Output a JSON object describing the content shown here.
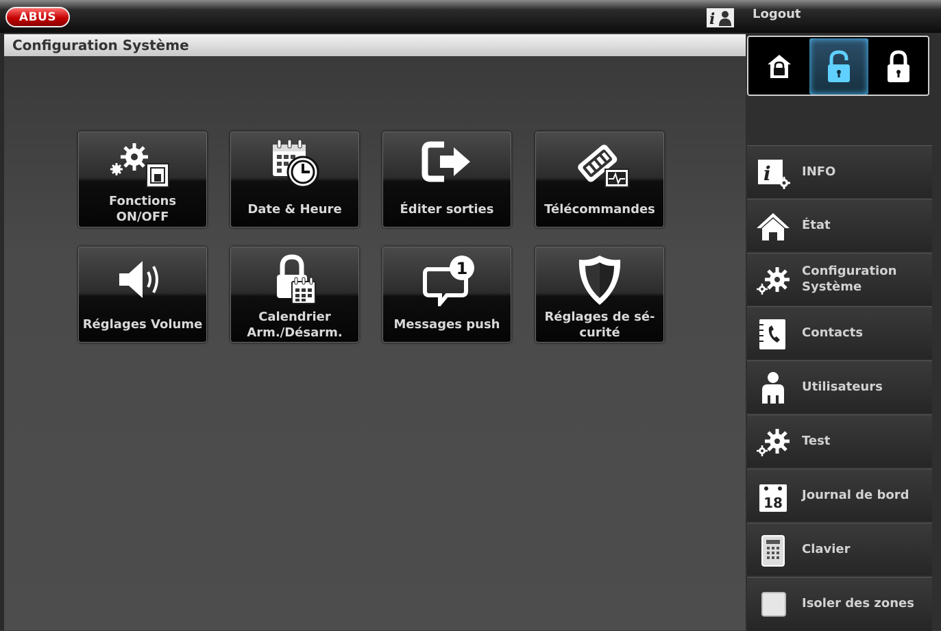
{
  "header": {
    "logo_text": "ABUS",
    "logout_label": "Logout"
  },
  "page": {
    "title": "Configuration Système"
  },
  "tiles": [
    {
      "line1": "Fonctions",
      "line2": "ON/OFF",
      "icon": "gears-switch-icon"
    },
    {
      "line1": "Date & Heure",
      "line2": "",
      "icon": "calendar-clock-icon"
    },
    {
      "line1": "Éditer sorties",
      "line2": "",
      "icon": "exit-arrow-icon"
    },
    {
      "line1": "Télécommandes",
      "line2": "",
      "icon": "remote-control-icon"
    },
    {
      "line1": "Réglages Volume",
      "line2": "",
      "icon": "speaker-icon"
    },
    {
      "line1": "Calendrier",
      "line2": "Arm./Désarm.",
      "icon": "lock-calendar-icon"
    },
    {
      "line1": "Messages push",
      "line2": "",
      "icon": "message-bubble-icon",
      "badge": "1"
    },
    {
      "line1": "Réglages de sé-",
      "line2": "curité",
      "icon": "shield-icon"
    }
  ],
  "arm_buttons": [
    {
      "icon": "home-lock-icon"
    },
    {
      "icon": "unlocked-icon",
      "active": true
    },
    {
      "icon": "locked-icon"
    }
  ],
  "nav": [
    {
      "line1": "INFO",
      "line2": "",
      "icon": "info-gear-icon"
    },
    {
      "line1": "État",
      "line2": "",
      "icon": "house-icon"
    },
    {
      "line1": "Configuration",
      "line2": "Système",
      "icon": "gears-icon"
    },
    {
      "line1": "Contacts",
      "line2": "",
      "icon": "phone-book-icon"
    },
    {
      "line1": "Utilisateurs",
      "line2": "",
      "icon": "user-icon"
    },
    {
      "line1": "Test",
      "line2": "",
      "icon": "gears-test-icon"
    },
    {
      "line1": "Journal de bord",
      "line2": "",
      "icon": "calendar-18-icon",
      "icon_text": "18"
    },
    {
      "line1": "Clavier",
      "line2": "",
      "icon": "keypad-icon"
    },
    {
      "line1": "Isoler des zones",
      "line2": "",
      "icon": "zone-square-icon"
    }
  ],
  "colors": {
    "brand": "#c50000",
    "active_glow": "#4fc3ff",
    "label_text": "#d9d9d9"
  }
}
